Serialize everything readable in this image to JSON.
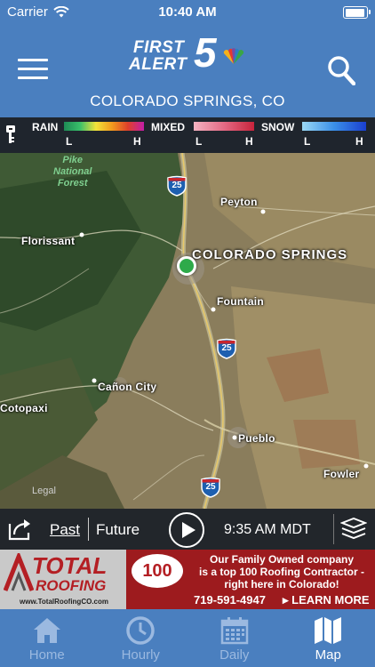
{
  "status_bar": {
    "carrier": "Carrier",
    "time": "10:40 AM"
  },
  "header": {
    "logo_line1": "FIRST",
    "logo_line2": "ALERT",
    "logo_number": "5",
    "location": "COLORADO SPRINGS, CO"
  },
  "legend": {
    "rain": "RAIN",
    "mixed": "MIXED",
    "snow": "SNOW",
    "low": "L",
    "high": "H",
    "colors": {
      "rain": [
        "#1e8a55",
        "#39c06a",
        "#f2e33a",
        "#f29a1e",
        "#e0402a",
        "#c21ea8"
      ],
      "mixed": [
        "#f5b3c2",
        "#e56a84",
        "#c8243c"
      ],
      "snow": [
        "#9ad8f5",
        "#3a8fe8",
        "#1a3fd0"
      ]
    }
  },
  "map": {
    "cities": {
      "colorado_springs": "COLORADO SPRINGS",
      "peyton": "Peyton",
      "florissant": "Florissant",
      "fountain": "Fountain",
      "canon_city": "Cañon City",
      "cotopaxi": "Cotopaxi",
      "pueblo": "Pueblo",
      "fowler": "Fowler"
    },
    "forest": {
      "line1": "Pike",
      "line2": "National",
      "line3": "Forest"
    },
    "highway": "25",
    "legal": "Legal"
  },
  "playback": {
    "past": "Past",
    "future": "Future",
    "time": "9:35 AM MDT"
  },
  "ad": {
    "brand_line1": "TOTAL",
    "brand_line2": "ROOFING",
    "url": "www.TotalRoofingCO.com",
    "badge": "100",
    "tagline_line1": "Our Family Owned company",
    "tagline_line2": "is a top 100 Roofing Contractor -",
    "tagline_line3": "right here in Colorado!",
    "phone": "719-591-4947",
    "learn_more": "LEARN MORE"
  },
  "tabs": [
    {
      "label": "Home",
      "icon": "home-icon"
    },
    {
      "label": "Hourly",
      "icon": "clock-icon"
    },
    {
      "label": "Daily",
      "icon": "calendar-icon"
    },
    {
      "label": "Map",
      "icon": "map-icon",
      "active": true
    }
  ]
}
